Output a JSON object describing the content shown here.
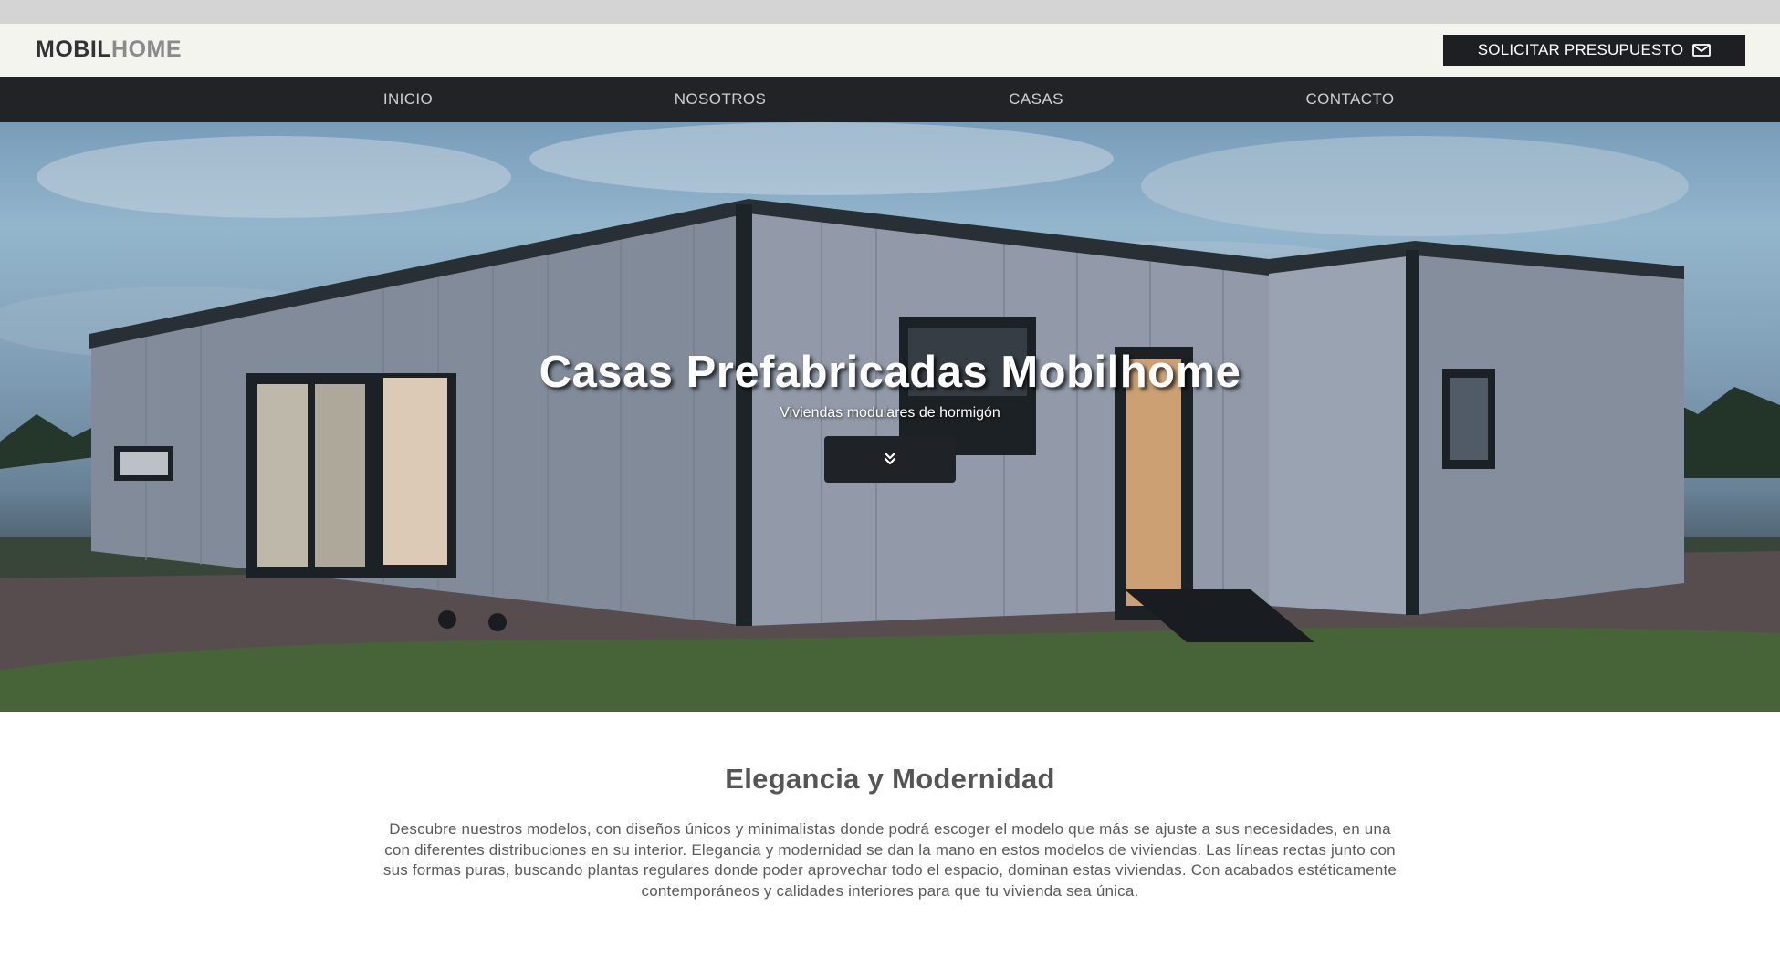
{
  "header": {
    "logo_part1": "MOBIL",
    "logo_part2": "HOME",
    "cta_label": "SOLICITAR PRESUPUESTO",
    "cta_icon": "envelope-icon"
  },
  "nav": {
    "items": [
      {
        "label": "INICIO"
      },
      {
        "label": "NOSOTROS"
      },
      {
        "label": "CASAS"
      },
      {
        "label": "CONTACTO"
      }
    ]
  },
  "hero": {
    "title": "Casas Prefabricadas Mobilhome",
    "subtitle": "Viviendas modulares de hormigón",
    "button_icon": "double-chevron-down-icon"
  },
  "section": {
    "title": "Elegancia y Modernidad",
    "text": "Descubre nuestros modelos, con diseños únicos y minimalistas donde podrá escoger el modelo que más se ajuste a sus necesidades, en una con diferentes distribuciones en su interior. Elegancia y modernidad se dan la mano en estos modelos de viviendas. Las líneas rectas junto con sus formas puras, buscando plantas regulares donde poder aprovechar todo el espacio, dominan estas viviendas. Con acabados estéticamente contemporáneos y calidades interiores para que tu vivienda sea única."
  },
  "colors": {
    "topbar_bg": "#f4f4ef",
    "nav_bg": "#222327",
    "cta_bg": "#1d1f22",
    "text_gray": "#555555"
  }
}
